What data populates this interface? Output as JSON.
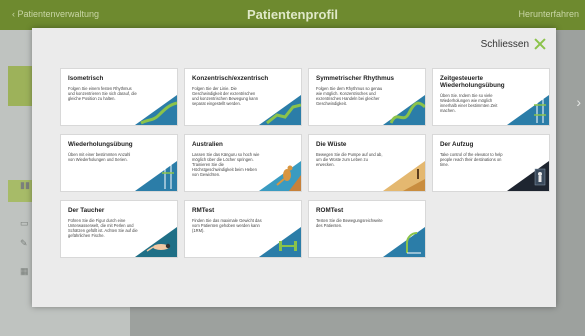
{
  "background": {
    "back_label": "‹ Patientenverwaltung",
    "title": "Patientenprofil",
    "download_label": "Herunterfahren"
  },
  "modal": {
    "close_label": "Schliessen",
    "tiles": [
      {
        "title": "Isometrisch",
        "desc": "Folgen Sie einem festen Rhythmus und konzentrieren Sie sich darauf, die gleiche Position zu halten.",
        "icon": "green-path-icon"
      },
      {
        "title": "Konzentrisch/exzentrisch",
        "desc": "Folgen Sie der Linie. Die Geschwindigkeit der exzentrischen und konzentrischen Bewegung kann separat eingestellt werden.",
        "icon": "green-path-icon"
      },
      {
        "title": "Symmetrischer Rhythmus",
        "desc": "Folgen Sie dem Rhythmus so genau wie möglich. Konzentrisches und exzentrisches Handeln bei gleicher Geschwindigkeit.",
        "icon": "green-wave-icon"
      },
      {
        "title": "Zeitgesteuerte Wiederholungsübung",
        "desc": "Üben Sie. Indem Sie so viele Wiederholungen wie möglich innerhalb einer bestimmten Zeit machen.",
        "icon": "timer-bars-icon"
      },
      {
        "title": "Wiederholungsübung",
        "desc": "Üben mit einer bestimmten Anzahl von Wiederholungen und Serien.",
        "icon": "repetition-bars-icon"
      },
      {
        "title": "Australien",
        "desc": "Lassen Sie das Känguru so hoch wie möglich über die Löcher springen. Trainieren Sie die Höchstgeschwindigkeit beim Heben von Gewichten.",
        "icon": "kangaroo-icon"
      },
      {
        "title": "Die Wüste",
        "desc": "Bewegen Sie die Pumpe auf und ab, um die Wüste zum Leben zu erwecken.",
        "icon": "desert-icon"
      },
      {
        "title": "Der Aufzug",
        "desc": "Take control of the elevator to help people reach their destinations on time.",
        "icon": "elevator-icon"
      },
      {
        "title": "Der Taucher",
        "desc": "Führen Sie die Figur durch eine Unterwasserwelt, die mit Perlen und Schätzen gefüllt ist. Achten Sie auf die gefährlichen Fische.",
        "icon": "diver-icon"
      },
      {
        "title": "RMTest",
        "desc": "Finden Sie das maximale Gewicht das vom Patienten gehoben werden kann (1RM).",
        "icon": "dumbbell-icon"
      },
      {
        "title": "ROMTest",
        "desc": "Testen Sie die Bewegungsreichweite des Patienten.",
        "icon": "range-of-motion-icon"
      }
    ]
  }
}
